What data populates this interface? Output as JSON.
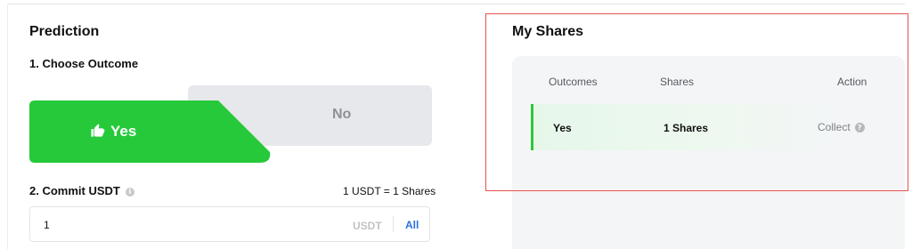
{
  "prediction": {
    "title": "Prediction",
    "choose_label": "1. Choose Outcome",
    "yes_label": "Yes",
    "no_label": "No",
    "commit_label": "2. Commit USDT",
    "rate_text": "1 USDT = 1 Shares",
    "input_value": "1",
    "input_unit": "USDT",
    "all_label": "All"
  },
  "my_shares": {
    "title": "My Shares",
    "headers": {
      "outcomes": "Outcomes",
      "shares": "Shares",
      "action": "Action"
    },
    "rows": [
      {
        "outcome": "Yes",
        "shares": "1 Shares",
        "action": "Collect"
      }
    ]
  },
  "colors": {
    "yes_green": "#26c93a",
    "no_gray": "#e6e8eb",
    "link_blue": "#2f6fdc",
    "highlight_red": "#e8514f"
  },
  "icons": {
    "yes": "thumbs-up-icon",
    "info": "info-icon",
    "help": "question-icon"
  }
}
